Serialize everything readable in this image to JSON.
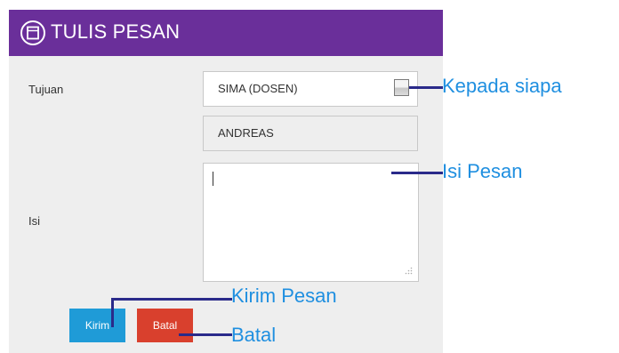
{
  "header": {
    "title": "TULIS PESAN",
    "icon": "window-icon"
  },
  "form": {
    "tujuan_label": "Tujuan",
    "tujuan_value": "SIMA (DOSEN)",
    "recipient_value": "ANDREAS",
    "isi_label": "Isi",
    "isi_value": ""
  },
  "buttons": {
    "kirim": "Kirim",
    "batal": "Batal"
  },
  "annotations": {
    "kepada": "Kepada siapa",
    "isi_pesan": "Isi Pesan",
    "kirim_pesan": "Kirim Pesan",
    "batal": "Batal"
  },
  "colors": {
    "header": "#6a2f9a",
    "kirim": "#1f9bd7",
    "batal": "#d9402d",
    "annotation_text": "#1f8fe0",
    "annotation_line": "#2a2a8a"
  }
}
